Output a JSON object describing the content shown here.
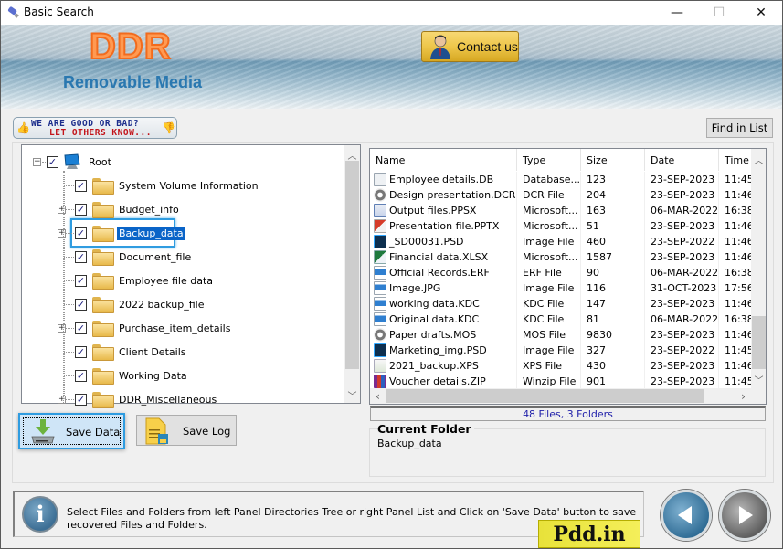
{
  "window": {
    "title": "Basic Search",
    "controls": {
      "minimize": "—",
      "maximize": "☐",
      "close": "✕"
    }
  },
  "header": {
    "logo": "DDR",
    "subtitle": "Removable Media",
    "contact_label": "Contact us"
  },
  "rate_badge": {
    "line1": "WE ARE GOOD OR BAD?",
    "line2": "LET OTHERS KNOW..."
  },
  "find_in_list_label": "Find in List",
  "tree": {
    "root": {
      "label": "Root",
      "checked": true,
      "expanded": true
    },
    "items": [
      {
        "label": "System Volume Information",
        "checked": true,
        "expandable": false,
        "selected": false
      },
      {
        "label": "Budget_info",
        "checked": true,
        "expandable": true,
        "selected": false
      },
      {
        "label": "Backup_data",
        "checked": true,
        "expandable": true,
        "selected": true
      },
      {
        "label": "Document_file",
        "checked": true,
        "expandable": false,
        "selected": false
      },
      {
        "label": "Employee file data",
        "checked": true,
        "expandable": false,
        "selected": false
      },
      {
        "label": "2022 backup_file",
        "checked": true,
        "expandable": false,
        "selected": false
      },
      {
        "label": "Purchase_item_details",
        "checked": true,
        "expandable": true,
        "selected": false
      },
      {
        "label": "Client Details",
        "checked": true,
        "expandable": false,
        "selected": false
      },
      {
        "label": "Working Data",
        "checked": true,
        "expandable": false,
        "selected": false
      },
      {
        "label": "DDR_Miscellaneous",
        "checked": true,
        "expandable": true,
        "selected": false
      }
    ]
  },
  "file_list": {
    "columns": [
      "Name",
      "Type",
      "Size",
      "Date",
      "Time"
    ],
    "rows": [
      {
        "icon": "database-file-icon",
        "name": "Employee details.DB",
        "type": "Database...",
        "size": "123",
        "date": "23-SEP-2023",
        "time": "11:45"
      },
      {
        "icon": "gear-file-icon",
        "name": "Design presentation.DCR",
        "type": "DCR File",
        "size": "204",
        "date": "23-SEP-2023",
        "time": "11:46"
      },
      {
        "icon": "powerpoint-show-icon",
        "name": "Output files.PPSX",
        "type": "Microsoft...",
        "size": "163",
        "date": "06-MAR-2022",
        "time": "16:38"
      },
      {
        "icon": "powerpoint-icon",
        "name": "Presentation file.PPTX",
        "type": "Microsoft...",
        "size": "51",
        "date": "23-SEP-2023",
        "time": "11:46"
      },
      {
        "icon": "photoshop-icon",
        "name": "_SD00031.PSD",
        "type": "Image File",
        "size": "460",
        "date": "23-SEP-2022",
        "time": "11:46"
      },
      {
        "icon": "excel-icon",
        "name": "Financial data.XLSX",
        "type": "Microsoft...",
        "size": "1587",
        "date": "23-SEP-2023",
        "time": "11:46"
      },
      {
        "icon": "image-file-icon",
        "name": "Official Records.ERF",
        "type": "ERF File",
        "size": "90",
        "date": "06-MAR-2022",
        "time": "16:38"
      },
      {
        "icon": "image-file-icon",
        "name": "Image.JPG",
        "type": "Image File",
        "size": "116",
        "date": "31-OCT-2023",
        "time": "17:56"
      },
      {
        "icon": "image-file-icon",
        "name": "working data.KDC",
        "type": "KDC File",
        "size": "147",
        "date": "23-SEP-2023",
        "time": "11:46"
      },
      {
        "icon": "image-file-icon",
        "name": "Original data.KDC",
        "type": "KDC File",
        "size": "81",
        "date": "06-MAR-2022",
        "time": "16:38"
      },
      {
        "icon": "gear-file-icon",
        "name": "Paper drafts.MOS",
        "type": "MOS File",
        "size": "9830",
        "date": "23-SEP-2023",
        "time": "11:46"
      },
      {
        "icon": "photoshop-icon",
        "name": "Marketing_img.PSD",
        "type": "Image File",
        "size": "327",
        "date": "23-SEP-2022",
        "time": "11:45"
      },
      {
        "icon": "xps-file-icon",
        "name": "2021_backup.XPS",
        "type": "XPS File",
        "size": "430",
        "date": "23-SEP-2023",
        "time": "11:46"
      },
      {
        "icon": "winzip-icon",
        "name": "Voucher details.ZIP",
        "type": "Winzip File",
        "size": "901",
        "date": "23-SEP-2023",
        "time": "11:45"
      }
    ]
  },
  "status": "48 Files, 3 Folders",
  "current_folder": {
    "legend": "Current Folder",
    "value": "Backup_data"
  },
  "buttons": {
    "save_data": "Save Data",
    "save_log": "Save Log"
  },
  "info": {
    "text": "Select Files and Folders from left Panel Directories Tree or right Panel List and Click on 'Save Data' button to save recovered Files and Folders."
  },
  "watermark": "Pdd.in"
}
